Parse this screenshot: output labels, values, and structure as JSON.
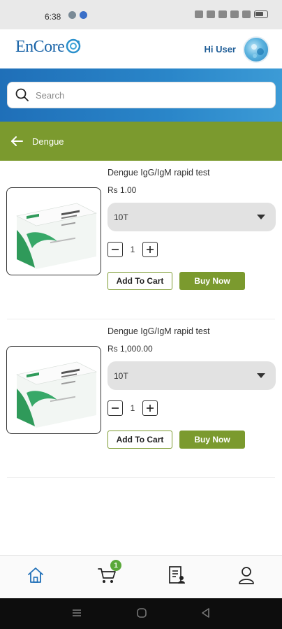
{
  "status_bar": {
    "time": "6:38"
  },
  "header": {
    "logo_text": "EnCore",
    "greeting": "Hi User"
  },
  "search": {
    "placeholder": "Search"
  },
  "category": {
    "title": "Dengue"
  },
  "products": [
    {
      "name": "Dengue IgG/IgM rapid test",
      "price": "Rs 1.00",
      "variant": "10T",
      "quantity": "1",
      "add_to_cart_label": "Add To Cart",
      "buy_now_label": "Buy Now"
    },
    {
      "name": "Dengue IgG/IgM rapid test",
      "price": "Rs 1,000.00",
      "variant": "10T",
      "quantity": "1",
      "add_to_cart_label": "Add To Cart",
      "buy_now_label": "Buy Now"
    }
  ],
  "bottom_nav": {
    "items": [
      {
        "icon": "home-icon"
      },
      {
        "icon": "cart-icon",
        "badge": "1"
      },
      {
        "icon": "orders-icon"
      },
      {
        "icon": "profile-icon"
      }
    ]
  },
  "colors": {
    "brand_blue": "#1f6fb8",
    "accent_green": "#7b9a2e",
    "badge_green": "#5aa83a"
  }
}
